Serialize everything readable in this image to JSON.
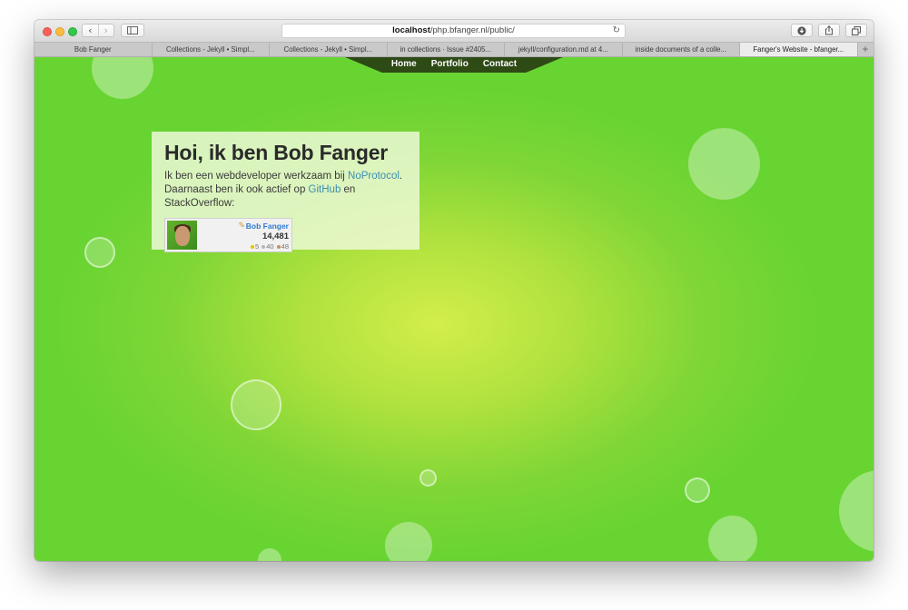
{
  "browser": {
    "address": {
      "host": "localhost",
      "path": "/php.bfanger.nl/public/"
    },
    "tabs": [
      {
        "label": "Bob Fanger",
        "active": false
      },
      {
        "label": "Collections - Jekyll • Simpl...",
        "active": false
      },
      {
        "label": "Collections - Jekyll • Simpl...",
        "active": false
      },
      {
        "label": "in collections · Issue #2405...",
        "active": false
      },
      {
        "label": "jekyll/configuration.md at 4...",
        "active": false
      },
      {
        "label": "inside documents of a colle...",
        "active": false
      },
      {
        "label": "Fanger's Website - bfanger...",
        "active": true
      }
    ],
    "new_tab_symbol": "+"
  },
  "site": {
    "nav": {
      "home": "Home",
      "portfolio": "Portfolio",
      "contact": "Contact"
    },
    "intro": {
      "heading": "Hoi, ik ben Bob Fanger",
      "line1_prefix": "Ik ben een webdeveloper werkzaam bij ",
      "line1_link": "NoProtocol",
      "line1_suffix": ".",
      "line2_prefix": "Daarnaast ben ik ook actief op ",
      "line2_link": "GitHub",
      "line2_suffix": " en StackOverflow:"
    },
    "flair": {
      "name": "Bob Fanger",
      "reputation": "14,481",
      "badges": {
        "gold": "5",
        "silver": "40",
        "bronze": "48"
      }
    }
  },
  "colors": {
    "background_center": "#d3ee4a",
    "background_edge": "#68d432",
    "nav_bg": "#2e4a15",
    "link": "#3a8fb0"
  }
}
